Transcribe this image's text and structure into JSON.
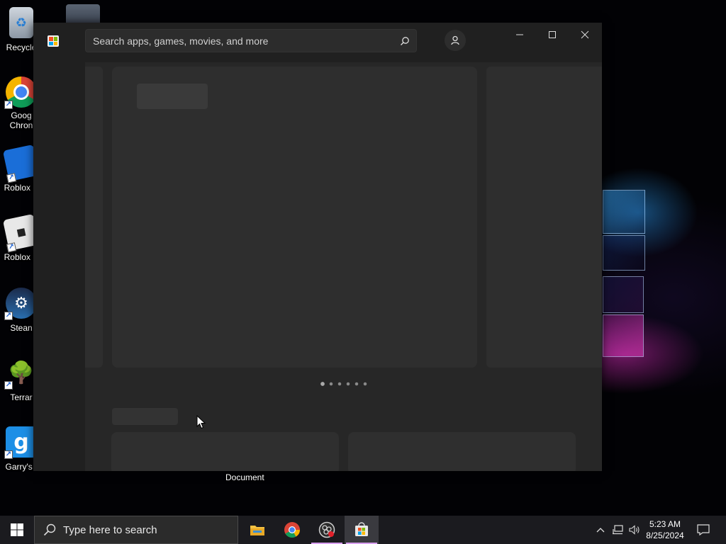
{
  "desktop": {
    "icons": [
      {
        "label": "Recycle",
        "icon": "recycle-bin-icon"
      },
      {
        "label": "Goog\nChron",
        "icon": "chrome-icon"
      },
      {
        "label": "Roblox S",
        "icon": "roblox-studio-icon"
      },
      {
        "label": "Roblox P",
        "icon": "roblox-player-icon"
      },
      {
        "label": "Stean",
        "icon": "steam-icon"
      },
      {
        "label": "Terrar",
        "icon": "terraria-icon"
      },
      {
        "label": "Garry's I",
        "icon": "garrys-mod-icon"
      }
    ],
    "tooltip": "Document"
  },
  "store_window": {
    "app_icon": "microsoft-store-icon",
    "search": {
      "placeholder": "Search apps, games, movies, and more",
      "value": ""
    },
    "account_icon": "account-icon",
    "controls": {
      "minimize": "minimize-icon",
      "maximize": "maximize-icon",
      "close": "close-icon"
    },
    "carousel": {
      "page_count": 6,
      "active_index": 0
    }
  },
  "taskbar": {
    "search_placeholder": "Type here to search",
    "apps": [
      {
        "name": "File Explorer",
        "icon": "file-explorer-icon",
        "active": false
      },
      {
        "name": "Google Chrome",
        "icon": "chrome-icon",
        "active": false
      },
      {
        "name": "OBS",
        "icon": "obs-icon",
        "active": false
      },
      {
        "name": "Microsoft Store",
        "icon": "microsoft-store-icon",
        "active": true
      }
    ],
    "tray": {
      "chevron": "chevron-up-icon",
      "network": "network-icon",
      "volume": "volume-icon",
      "time": "5:23 AM",
      "date": "8/25/2024",
      "notifications": "notification-icon"
    }
  },
  "colors": {
    "window_bg": "#202020",
    "content_bg": "#272727",
    "skeleton": "#2f2f2f",
    "taskbar_bg": "#1b1b1f",
    "active_indicator": "#d9a0f0"
  }
}
